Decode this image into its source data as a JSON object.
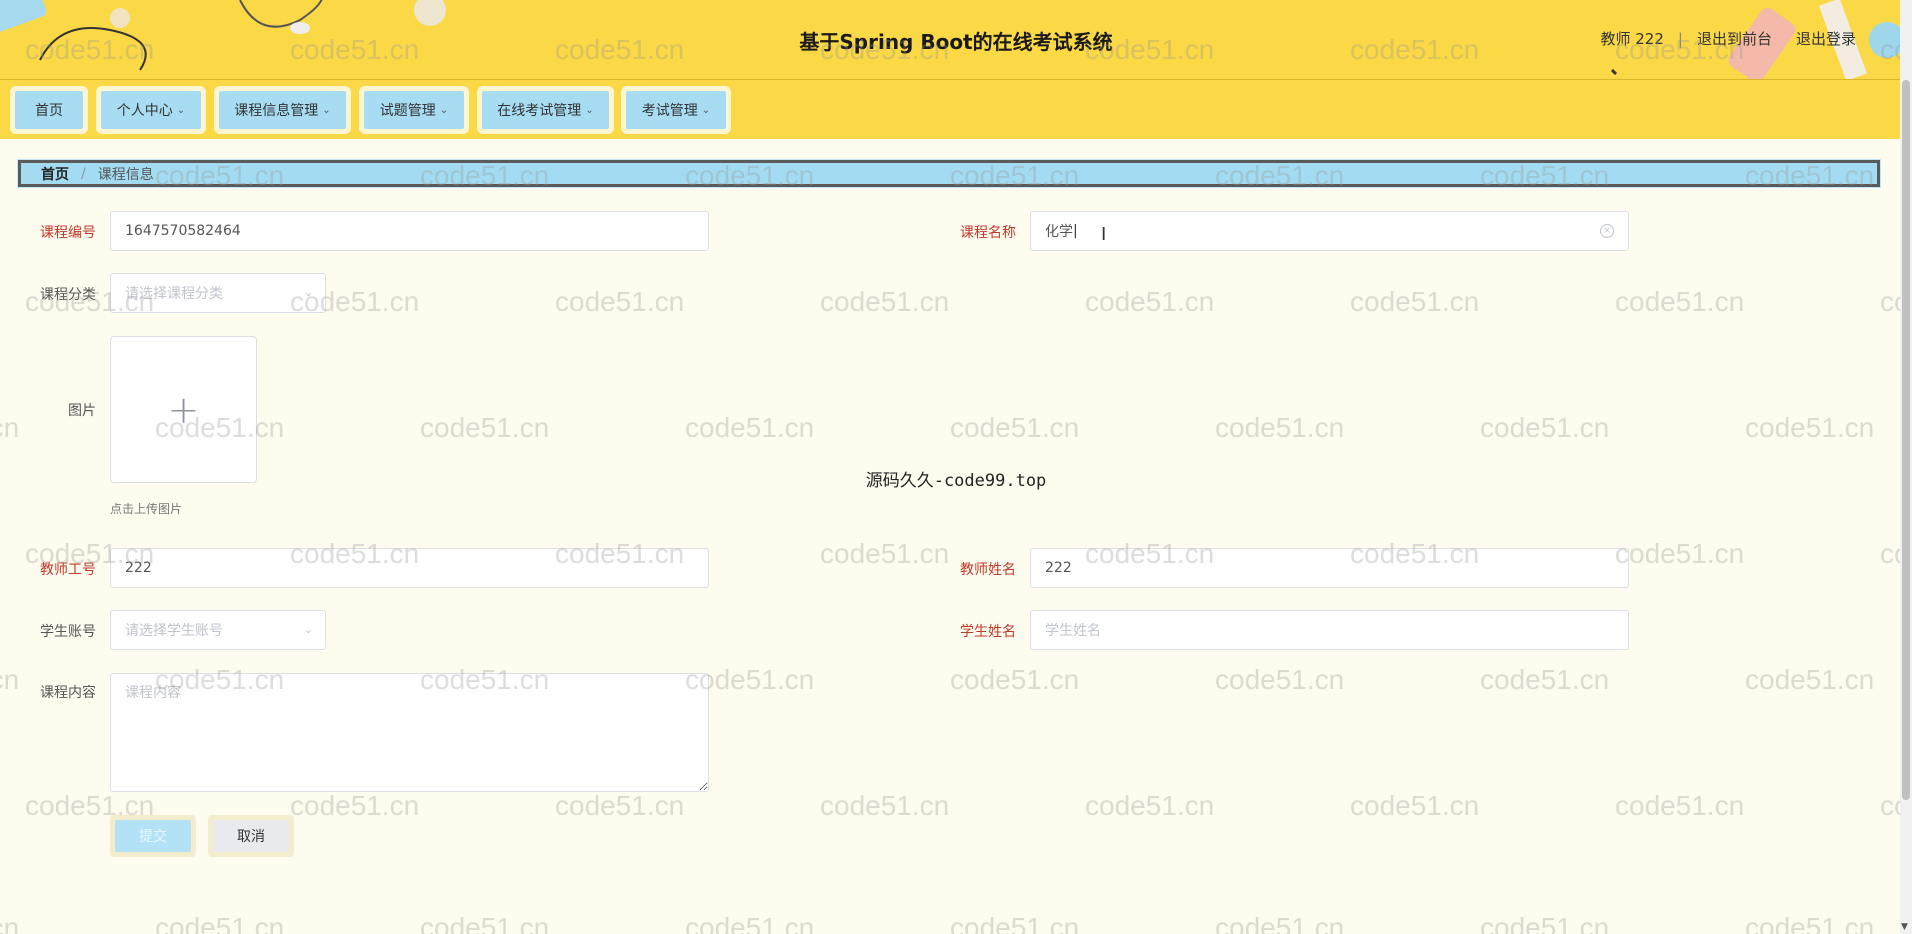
{
  "header": {
    "title": "基于Spring Boot的在线考试系统",
    "user_label": "教师 222",
    "links": [
      "退出到前台",
      "退出登录"
    ]
  },
  "nav": {
    "items": [
      {
        "label": "首页",
        "dropdown": false
      },
      {
        "label": "个人中心",
        "dropdown": true
      },
      {
        "label": "课程信息管理",
        "dropdown": true
      },
      {
        "label": "试题管理",
        "dropdown": true
      },
      {
        "label": "在线考试管理",
        "dropdown": true
      },
      {
        "label": "考试管理",
        "dropdown": true
      }
    ]
  },
  "breadcrumb": {
    "home": "首页",
    "current": "课程信息"
  },
  "form": {
    "course_no": {
      "label": "课程编号",
      "value": "1647570582464"
    },
    "course_name": {
      "label": "课程名称",
      "value": "化学"
    },
    "course_category": {
      "label": "课程分类",
      "placeholder": "请选择课程分类"
    },
    "image": {
      "label": "图片",
      "hint": "点击上传图片"
    },
    "teacher_no": {
      "label": "教师工号",
      "value": "222"
    },
    "teacher_name": {
      "label": "教师姓名",
      "value": "222"
    },
    "student_account": {
      "label": "学生账号",
      "placeholder": "请选择学生账号"
    },
    "student_name": {
      "label": "学生姓名",
      "placeholder": "学生姓名"
    },
    "course_content": {
      "label": "课程内容",
      "placeholder": "课程内容"
    },
    "submit_label": "提交",
    "cancel_label": "取消"
  },
  "overlay_text": "源码久久-code99.top",
  "watermark": "code51.cn",
  "colors": {
    "header_bg": "#fbd846",
    "nav_button": "#a7dcf3",
    "page_bg": "#fefcee",
    "required_label": "#c0392b"
  }
}
